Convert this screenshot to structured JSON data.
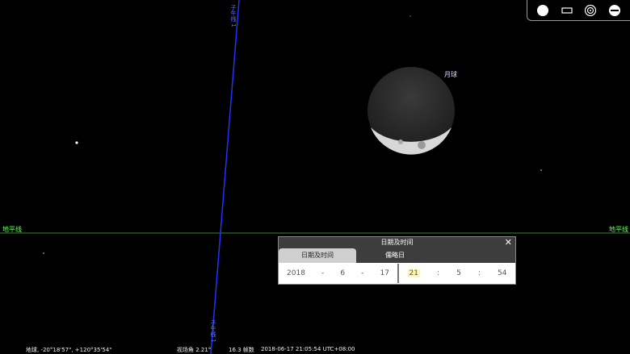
{
  "toolbar": {
    "buttons": [
      {
        "name": "moon-phase-icon"
      },
      {
        "name": "window-icon"
      },
      {
        "name": "target-icon"
      },
      {
        "name": "minus-circle-icon"
      }
    ]
  },
  "sky": {
    "horizon_label_left": "地平线",
    "horizon_label_right": "地平线",
    "moon_label": "月球",
    "meridian_label_top": "子午线 1",
    "meridian_label_bottom": "子午线 1"
  },
  "dialog": {
    "title": "日期及时间",
    "close": "✕",
    "tabs": [
      "日期及时间",
      "儒略日"
    ],
    "date": {
      "year": "2018",
      "sep1": "-",
      "month": "6",
      "sep2": "-",
      "day": "17"
    },
    "time": {
      "hour": "21",
      "sep1": ":",
      "minute": "5",
      "sep2": ":",
      "second": "54"
    }
  },
  "status": {
    "location": "地球, -20°18'57\", +120°35'54\"",
    "fov": "视场角 2.21°",
    "fps": "16.3 帧数",
    "datetime": "2018-06-17 21:05:54 UTC+08:00"
  },
  "colors": {
    "horizon": "#2f8a2f",
    "meridian": "#2233ff",
    "background": "#000000"
  }
}
